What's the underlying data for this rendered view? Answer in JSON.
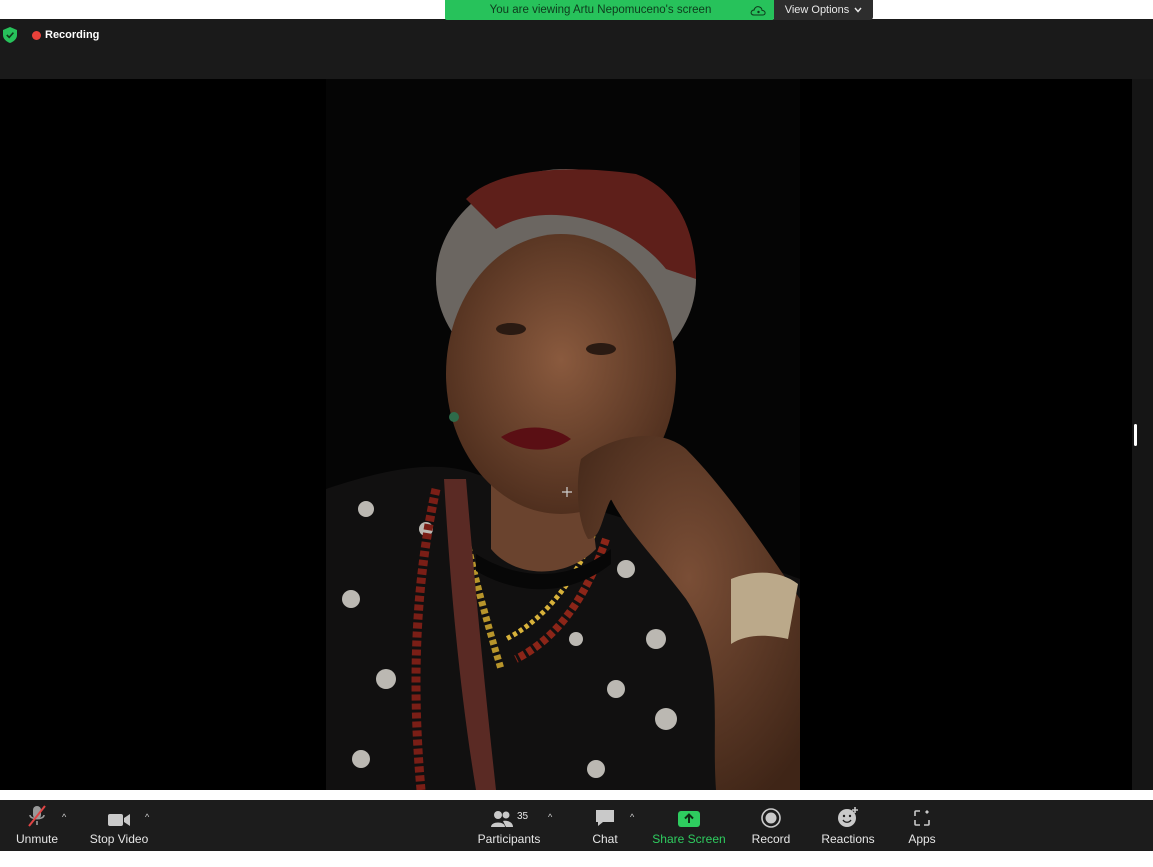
{
  "status": {
    "recording_label": "Recording",
    "banner_text": "You are viewing Artu Nepomuceno's screen",
    "view_options_label": "View Options",
    "accent_green": "#27c25b",
    "recording_red": "#e8413a"
  },
  "toolbar": {
    "unmute_label": "Unmute",
    "stop_video_label": "Stop Video",
    "participants_label": "Participants",
    "participants_count": "35",
    "chat_label": "Chat",
    "share_screen_label": "Share Screen",
    "record_label": "Record",
    "reactions_label": "Reactions",
    "apps_label": "Apps"
  },
  "icons": [
    "shield-icon",
    "recording-dot-icon",
    "cloud-icon",
    "chevron-down-icon",
    "microphone-muted-icon",
    "video-camera-icon",
    "participants-icon",
    "chat-bubble-icon",
    "share-screen-icon",
    "record-icon",
    "reactions-icon",
    "apps-icon",
    "move-cursor-icon"
  ]
}
